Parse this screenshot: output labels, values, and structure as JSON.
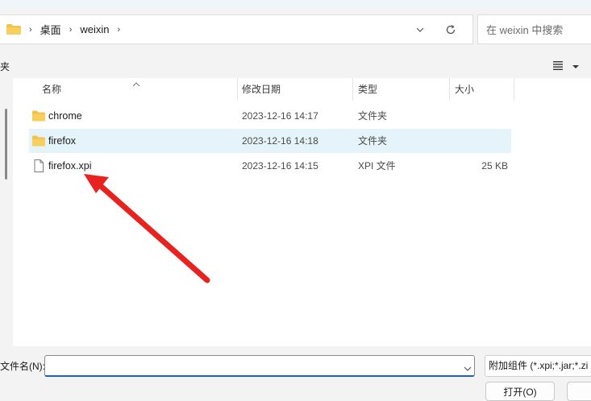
{
  "breadcrumb": {
    "items": [
      "桌面",
      "weixin"
    ]
  },
  "search": {
    "placeholder": "在 weixin 中搜索"
  },
  "toolbar": {
    "left_text": "夹"
  },
  "columns": {
    "name": "名称",
    "modified": "修改日期",
    "type": "类型",
    "size": "大小"
  },
  "files": [
    {
      "name": "chrome",
      "modified": "2023-12-16 14:17",
      "type": "文件夹",
      "size": "",
      "icon": "folder-icon"
    },
    {
      "name": "firefox",
      "modified": "2023-12-16 14:18",
      "type": "文件夹",
      "size": "",
      "icon": "folder-icon",
      "selected": true
    },
    {
      "name": "firefox.xpi",
      "modified": "2023-12-16 14:15",
      "type": "XPI 文件",
      "size": "25 KB",
      "icon": "file-icon"
    }
  ],
  "footer": {
    "filename_label": "文件名(N):",
    "filename_value": "",
    "filter": "附加组件 (*.xpi;*.jar;*.zi",
    "open_label": "打开(O)"
  },
  "colors": {
    "accent": "#1f5fbf",
    "selection": "#e5f3fb",
    "folder": "#f2c04b",
    "arrow": "#e8231f"
  }
}
